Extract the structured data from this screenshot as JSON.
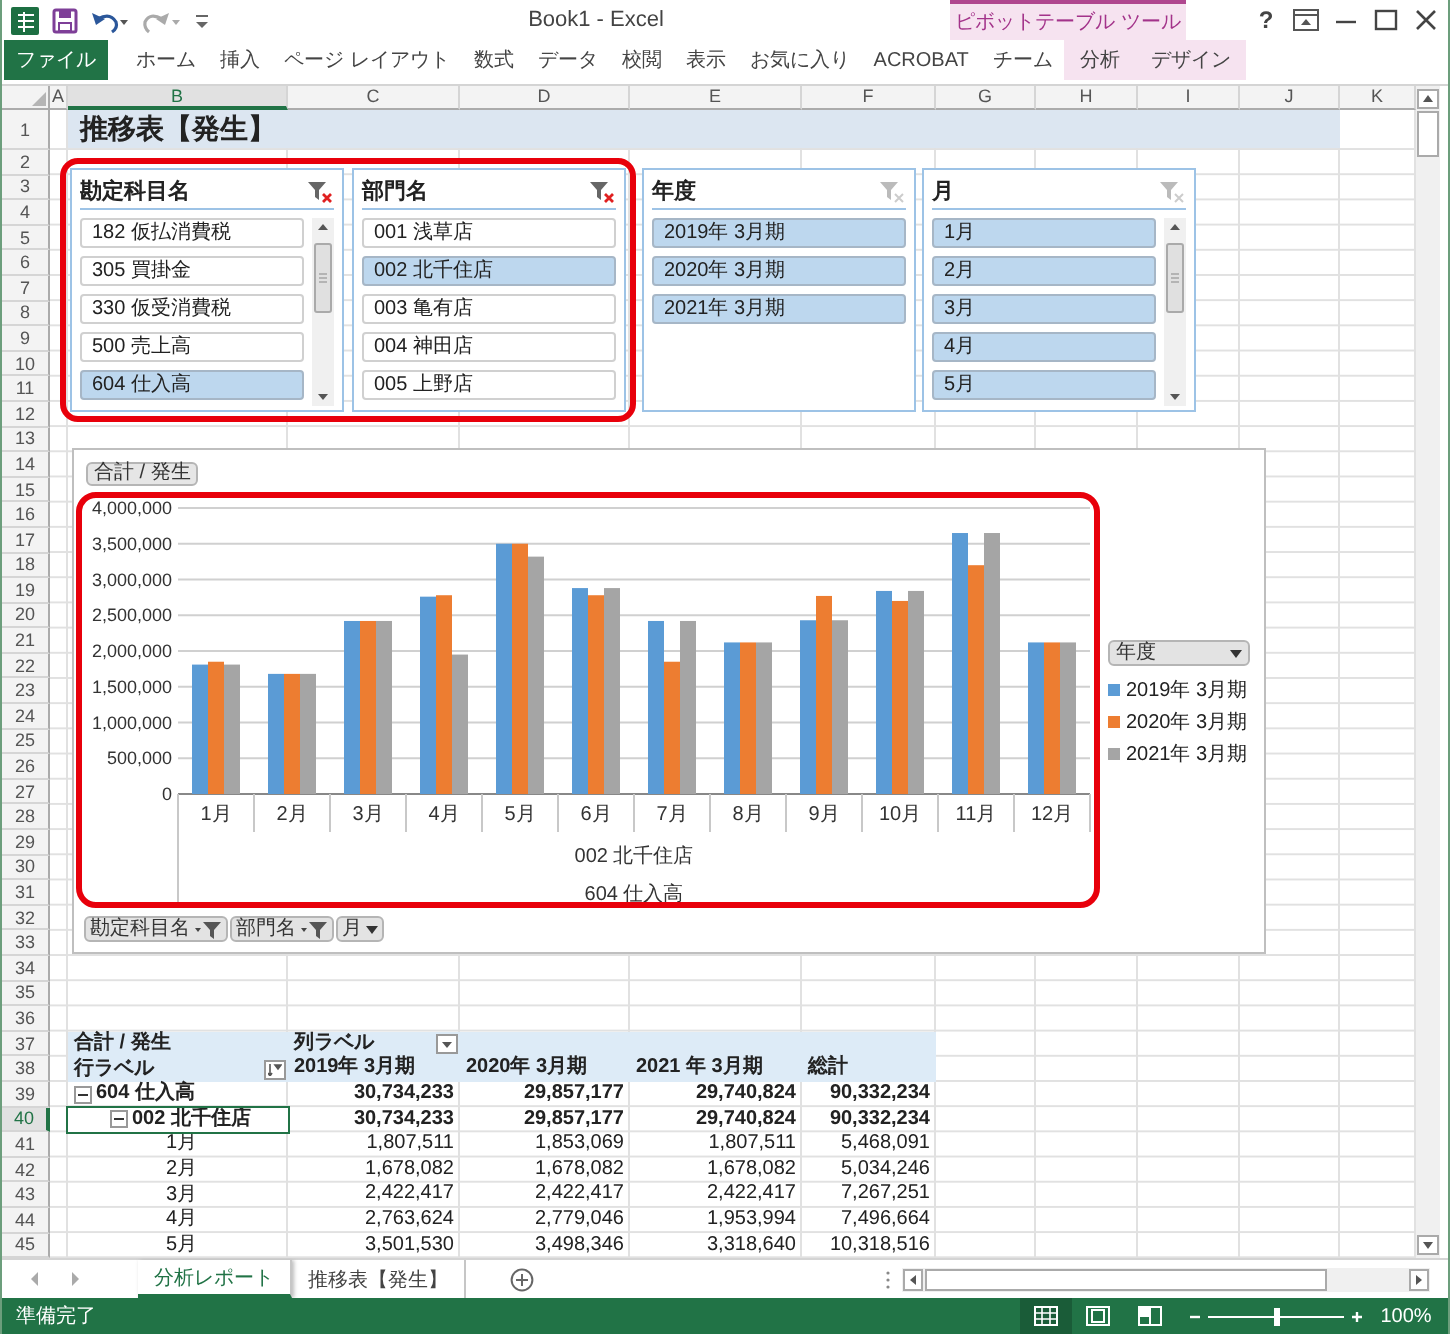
{
  "window": {
    "title": "Book1 - Excel",
    "context_label": "ピボットテーブル ツール",
    "help": "?"
  },
  "ribbon_tabs": [
    {
      "label": "ファイル",
      "kind": "file"
    },
    {
      "label": "ホーム",
      "kind": "standard"
    },
    {
      "label": "挿入",
      "kind": "standard"
    },
    {
      "label": "ページ レイアウト",
      "kind": "standard"
    },
    {
      "label": "数式",
      "kind": "standard"
    },
    {
      "label": "データ",
      "kind": "standard"
    },
    {
      "label": "校閲",
      "kind": "standard"
    },
    {
      "label": "表示",
      "kind": "standard"
    },
    {
      "label": "お気に入り",
      "kind": "standard"
    },
    {
      "label": "ACROBAT",
      "kind": "standard"
    },
    {
      "label": "チーム",
      "kind": "standard"
    },
    {
      "label": "分析",
      "kind": "context"
    },
    {
      "label": "デザイン",
      "kind": "context"
    }
  ],
  "sheet": {
    "title_cell": "推移表【発生】",
    "columns": [
      {
        "label": "A",
        "selected": false
      },
      {
        "label": "B",
        "selected": true
      },
      {
        "label": "C",
        "selected": false
      },
      {
        "label": "D",
        "selected": false
      },
      {
        "label": "E",
        "selected": false
      },
      {
        "label": "F",
        "selected": false
      },
      {
        "label": "G",
        "selected": false
      },
      {
        "label": "H",
        "selected": false
      },
      {
        "label": "I",
        "selected": false
      },
      {
        "label": "J",
        "selected": false
      },
      {
        "label": "K",
        "selected": false
      }
    ],
    "rows": [
      {
        "label": "1",
        "selected": false
      },
      {
        "label": "2",
        "selected": false
      },
      {
        "label": "3",
        "selected": false
      },
      {
        "label": "4",
        "selected": false
      },
      {
        "label": "5",
        "selected": false
      },
      {
        "label": "6",
        "selected": false
      },
      {
        "label": "7",
        "selected": false
      },
      {
        "label": "8",
        "selected": false
      },
      {
        "label": "9",
        "selected": false
      },
      {
        "label": "10",
        "selected": false
      },
      {
        "label": "11",
        "selected": false
      },
      {
        "label": "12",
        "selected": false
      },
      {
        "label": "13",
        "selected": false
      },
      {
        "label": "14",
        "selected": false
      },
      {
        "label": "15",
        "selected": false
      },
      {
        "label": "16",
        "selected": false
      },
      {
        "label": "17",
        "selected": false
      },
      {
        "label": "18",
        "selected": false
      },
      {
        "label": "19",
        "selected": false
      },
      {
        "label": "20",
        "selected": false
      },
      {
        "label": "21",
        "selected": false
      },
      {
        "label": "22",
        "selected": false
      },
      {
        "label": "23",
        "selected": false
      },
      {
        "label": "24",
        "selected": false
      },
      {
        "label": "25",
        "selected": false
      },
      {
        "label": "26",
        "selected": false
      },
      {
        "label": "27",
        "selected": false
      },
      {
        "label": "28",
        "selected": false
      },
      {
        "label": "29",
        "selected": false
      },
      {
        "label": "30",
        "selected": false
      },
      {
        "label": "31",
        "selected": false
      },
      {
        "label": "32",
        "selected": false
      },
      {
        "label": "33",
        "selected": false
      },
      {
        "label": "34",
        "selected": false
      },
      {
        "label": "35",
        "selected": false
      },
      {
        "label": "36",
        "selected": false
      },
      {
        "label": "37",
        "selected": false
      },
      {
        "label": "38",
        "selected": false
      },
      {
        "label": "39",
        "selected": false
      },
      {
        "label": "40",
        "selected": true
      },
      {
        "label": "41",
        "selected": false
      },
      {
        "label": "42",
        "selected": false
      },
      {
        "label": "43",
        "selected": false
      },
      {
        "label": "44",
        "selected": false
      },
      {
        "label": "45",
        "selected": false
      }
    ]
  },
  "slicers": [
    {
      "title": "勘定科目名",
      "clear_enabled": true,
      "scrollbar": true,
      "highlighted": true,
      "items": [
        {
          "label": "182 仮払消費税",
          "selected": false
        },
        {
          "label": "305 買掛金",
          "selected": false
        },
        {
          "label": "330 仮受消費税",
          "selected": false
        },
        {
          "label": "500 売上高",
          "selected": false
        },
        {
          "label": "604 仕入高",
          "selected": true
        }
      ]
    },
    {
      "title": "部門名",
      "clear_enabled": true,
      "scrollbar": false,
      "highlighted": true,
      "items": [
        {
          "label": "001 浅草店",
          "selected": false
        },
        {
          "label": "002 北千住店",
          "selected": true
        },
        {
          "label": "003 亀有店",
          "selected": false
        },
        {
          "label": "004 神田店",
          "selected": false
        },
        {
          "label": "005 上野店",
          "selected": false
        }
      ]
    },
    {
      "title": "年度",
      "clear_enabled": false,
      "scrollbar": false,
      "highlighted": false,
      "items": [
        {
          "label": "2019年  3月期",
          "selected": true
        },
        {
          "label": "2020年  3月期",
          "selected": true
        },
        {
          "label": "2021年  3月期",
          "selected": true
        }
      ]
    },
    {
      "title": "月",
      "clear_enabled": false,
      "scrollbar": true,
      "highlighted": false,
      "items": [
        {
          "label": "1月",
          "selected": true
        },
        {
          "label": "2月",
          "selected": true
        },
        {
          "label": "3月",
          "selected": true
        },
        {
          "label": "4月",
          "selected": true
        },
        {
          "label": "5月",
          "selected": true
        }
      ]
    }
  ],
  "chart": {
    "field_button": "合計 / 発生",
    "highlighted": true,
    "legend_title": "年度",
    "axis_groups": [
      "002 北千住店",
      "604 仕入高"
    ],
    "filter_buttons": [
      {
        "label": "勘定科目名",
        "kind": "filtered"
      },
      {
        "label": "部門名",
        "kind": "filtered"
      },
      {
        "label": "月",
        "kind": "dropdown"
      }
    ],
    "chart_data": {
      "type": "bar",
      "categories": [
        "1月",
        "2月",
        "3月",
        "4月",
        "5月",
        "6月",
        "7月",
        "8月",
        "9月",
        "10月",
        "11月",
        "12月"
      ],
      "series": [
        {
          "name": "2019年 3月期",
          "color": "#5b9bd5",
          "values": [
            1810000,
            1680000,
            2420000,
            2760000,
            3500000,
            2880000,
            2420000,
            2120000,
            2430000,
            2840000,
            3650000,
            2120000
          ]
        },
        {
          "name": "2020年 3月期",
          "color": "#ed7d31",
          "values": [
            1850000,
            1680000,
            2420000,
            2780000,
            3500000,
            2780000,
            1850000,
            2120000,
            2770000,
            2700000,
            3200000,
            2120000
          ]
        },
        {
          "name": "2021年 3月期",
          "color": "#a5a5a5",
          "values": [
            1810000,
            1680000,
            2420000,
            1950000,
            3320000,
            2880000,
            2420000,
            2120000,
            2430000,
            2840000,
            3650000,
            2120000
          ]
        }
      ],
      "ylim": [
        0,
        4000000
      ],
      "grid": true,
      "legend": "right",
      "yticks": [
        {
          "value": 0,
          "label": "0"
        },
        {
          "value": 500000,
          "label": "500,000"
        },
        {
          "value": 1000000,
          "label": "1,000,000"
        },
        {
          "value": 1500000,
          "label": "1,500,000"
        },
        {
          "value": 2000000,
          "label": "2,000,000"
        },
        {
          "value": 2500000,
          "label": "2,500,000"
        },
        {
          "value": 3000000,
          "label": "3,000,000"
        },
        {
          "value": 3500000,
          "label": "3,500,000"
        },
        {
          "value": 4000000,
          "label": "4,000,000"
        }
      ]
    }
  },
  "pivot_table": {
    "corner": "合計 / 発生",
    "column_label": "列ラベル",
    "row_label": "行ラベル",
    "columns": [
      "2019年  3月期",
      "2020年  3月期",
      "2021 年  3月期",
      "総計"
    ],
    "rows": [
      {
        "label": "604  仕入高",
        "expanded": true,
        "values": [
          "30,734,233",
          "29,857,177",
          "29,740,824",
          "90,332,234"
        ],
        "children": [
          {
            "label": "002  北千住店",
            "expanded": true,
            "active": true,
            "values": [
              "30,734,233",
              "29,857,177",
              "29,740,824",
              "90,332,234"
            ],
            "children": [
              {
                "label": "1月",
                "values": [
                  "1,807,511",
                  "1,853,069",
                  "1,807,511",
                  "5,468,091"
                ]
              },
              {
                "label": "2月",
                "values": [
                  "1,678,082",
                  "1,678,082",
                  "1,678,082",
                  "5,034,246"
                ]
              },
              {
                "label": "3月",
                "values": [
                  "2,422,417",
                  "2,422,417",
                  "2,422,417",
                  "7,267,251"
                ]
              },
              {
                "label": "4月",
                "values": [
                  "2,763,624",
                  "2,779,046",
                  "1,953,994",
                  "7,496,664"
                ]
              },
              {
                "label": "5月",
                "values": [
                  "3,501,530",
                  "3,498,346",
                  "3,318,640",
                  "10,318,516"
                ]
              }
            ]
          }
        ]
      }
    ]
  },
  "sheet_tabs": [
    {
      "label": "分析レポート",
      "selected": true
    },
    {
      "label": "推移表【発生】",
      "selected": false
    }
  ],
  "status_bar": {
    "text": "準備完了",
    "views": [
      {
        "kind": "normal",
        "selected": true
      },
      {
        "kind": "page_layout",
        "selected": false
      },
      {
        "kind": "page_break",
        "selected": false
      }
    ],
    "zoom_slider": {
      "level": 0.5
    },
    "zoom": "100%"
  }
}
